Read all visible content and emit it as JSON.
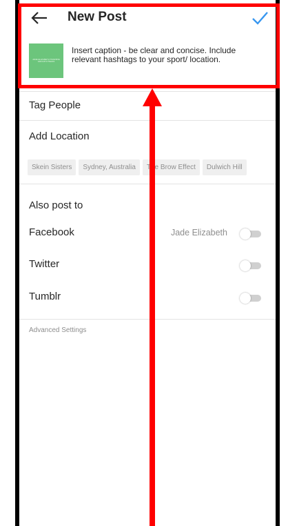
{
  "header": {
    "back_icon": "arrow-left-icon",
    "title": "New Post",
    "confirm_icon": "check-icon",
    "accent_color": "#3897f0"
  },
  "post": {
    "thumbnail_color": "#6cc57c",
    "thumbnail_text": "JADE ELIZABETH TRAINING GROUP FITNESS",
    "caption": "Insert caption - be clear and concise. Include relevant hashtags to your sport/ location."
  },
  "options": {
    "tag_people": "Tag People",
    "add_location": "Add Location"
  },
  "location_suggestions": [
    "Skein Sisters",
    "Sydney, Australia",
    "The Brow Effect",
    "Dulwich Hill"
  ],
  "share": {
    "title": "Also post to",
    "items": [
      {
        "label": "Facebook",
        "account": "Jade Elizabeth",
        "enabled": false
      },
      {
        "label": "Twitter",
        "account": "",
        "enabled": false
      },
      {
        "label": "Tumblr",
        "account": "",
        "enabled": false
      }
    ]
  },
  "advanced_settings": "Advanced Settings",
  "annotation_color": "#ff0000"
}
